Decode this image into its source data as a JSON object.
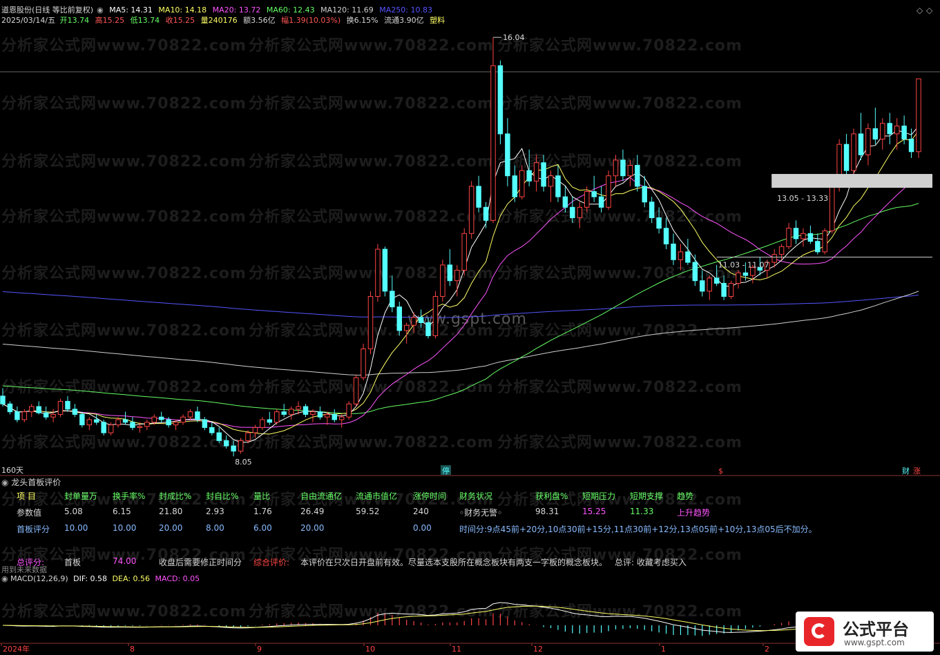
{
  "header": {
    "stock": "道恩股份(日线 等比前复权)",
    "ma": [
      {
        "label": "MA5: 14.31",
        "color": "#ffffff"
      },
      {
        "label": "MA10: 14.18",
        "color": "#ffff66"
      },
      {
        "label": "MA20: 13.72",
        "color": "#ff55ff"
      },
      {
        "label": "MA60: 12.43",
        "color": "#66ff66"
      },
      {
        "label": "MA120: 11.69",
        "color": "#d0d0d0"
      },
      {
        "label": "MA250: 10.83",
        "color": "#5555ff"
      }
    ],
    "date": "2025/03/14/五",
    "open_label": "开",
    "open": "13.74",
    "high_label": "高",
    "high": "15.25",
    "low_label": "低",
    "low": "13.74",
    "close_label": "收",
    "close": "15.25",
    "vol": "量240176",
    "amount": "额3.56亿",
    "change": "幅1.39(10.03%)",
    "turnover": "换6.15%",
    "float": "流通3.90亿",
    "industry": "塑料"
  },
  "watermarks": [
    "分析家公式网www.70822.com",
    "www.gspt.com"
  ],
  "chart_data": {
    "type": "candlestick",
    "period_label": "160天",
    "y_annotations": {
      "max": "16.04",
      "min": "8.05",
      "zone_high": "13.05 - 13.33",
      "zone_low": "11.03 - 11.07"
    },
    "x_ticks": [
      "2024年",
      "8",
      "9",
      "10",
      "11",
      "12",
      "1",
      "2"
    ],
    "markers": [
      "停",
      "$",
      "财",
      "涨"
    ],
    "ohlc": [
      [
        9.2,
        9.35,
        9.0,
        9.05
      ],
      [
        9.05,
        9.1,
        8.85,
        8.9
      ],
      [
        8.9,
        9.0,
        8.7,
        8.75
      ],
      [
        8.75,
        8.95,
        8.7,
        8.9
      ],
      [
        8.9,
        9.05,
        8.8,
        9.0
      ],
      [
        9.0,
        9.1,
        8.85,
        8.88
      ],
      [
        8.88,
        9.0,
        8.75,
        8.8
      ],
      [
        8.8,
        8.95,
        8.7,
        8.85
      ],
      [
        8.85,
        9.15,
        8.8,
        9.1
      ],
      [
        9.1,
        9.2,
        8.9,
        8.95
      ],
      [
        8.95,
        9.05,
        8.8,
        8.85
      ],
      [
        8.85,
        8.9,
        8.6,
        8.65
      ],
      [
        8.65,
        8.8,
        8.55,
        8.75
      ],
      [
        8.75,
        8.85,
        8.65,
        8.7
      ],
      [
        8.7,
        8.75,
        8.45,
        8.5
      ],
      [
        8.5,
        8.7,
        8.45,
        8.65
      ],
      [
        8.65,
        8.8,
        8.6,
        8.75
      ],
      [
        8.75,
        8.9,
        8.65,
        8.7
      ],
      [
        8.7,
        8.8,
        8.55,
        8.6
      ],
      [
        8.6,
        8.7,
        8.5,
        8.62
      ],
      [
        8.62,
        8.75,
        8.55,
        8.7
      ],
      [
        8.7,
        8.85,
        8.65,
        8.8
      ],
      [
        8.8,
        8.9,
        8.7,
        8.75
      ],
      [
        8.75,
        8.8,
        8.6,
        8.65
      ],
      [
        8.65,
        8.75,
        8.55,
        8.7
      ],
      [
        8.7,
        8.85,
        8.65,
        8.8
      ],
      [
        8.8,
        8.95,
        8.75,
        8.9
      ],
      [
        8.9,
        9.0,
        8.7,
        8.75
      ],
      [
        8.75,
        8.8,
        8.55,
        8.6
      ],
      [
        8.6,
        8.7,
        8.45,
        8.5
      ],
      [
        8.5,
        8.6,
        8.3,
        8.35
      ],
      [
        8.35,
        8.45,
        8.2,
        8.25
      ],
      [
        8.25,
        8.35,
        8.05,
        8.15
      ],
      [
        8.15,
        8.4,
        8.1,
        8.35
      ],
      [
        8.35,
        8.55,
        8.3,
        8.5
      ],
      [
        8.5,
        8.65,
        8.4,
        8.6
      ],
      [
        8.6,
        8.8,
        8.55,
        8.75
      ],
      [
        8.75,
        8.9,
        8.65,
        8.7
      ],
      [
        8.7,
        8.95,
        8.65,
        8.9
      ],
      [
        8.9,
        9.05,
        8.8,
        8.85
      ],
      [
        8.85,
        9.0,
        8.75,
        8.95
      ],
      [
        8.95,
        9.1,
        8.85,
        9.0
      ],
      [
        9.0,
        9.05,
        8.8,
        8.85
      ],
      [
        8.85,
        8.95,
        8.7,
        8.9
      ],
      [
        8.9,
        9.0,
        8.75,
        8.8
      ],
      [
        8.8,
        8.9,
        8.65,
        8.85
      ],
      [
        8.85,
        8.95,
        8.7,
        8.75
      ],
      [
        8.75,
        8.85,
        8.6,
        8.8
      ],
      [
        8.8,
        9.1,
        8.75,
        9.05
      ],
      [
        9.05,
        9.6,
        9.0,
        9.55
      ],
      [
        9.55,
        10.2,
        9.5,
        10.1
      ],
      [
        10.1,
        11.2,
        10.0,
        11.1
      ],
      [
        11.1,
        12.1,
        11.0,
        12.0
      ],
      [
        12.0,
        12.05,
        11.1,
        11.2
      ],
      [
        11.2,
        11.5,
        10.8,
        10.9
      ],
      [
        10.9,
        11.0,
        10.35,
        10.45
      ],
      [
        10.45,
        10.6,
        10.2,
        10.55
      ],
      [
        10.55,
        10.8,
        10.4,
        10.7
      ],
      [
        10.7,
        10.85,
        10.5,
        10.6
      ],
      [
        10.6,
        10.7,
        10.3,
        10.35
      ],
      [
        10.35,
        11.2,
        10.3,
        11.1
      ],
      [
        11.1,
        11.8,
        11.0,
        11.7
      ],
      [
        11.7,
        12.0,
        11.3,
        11.4
      ],
      [
        11.4,
        11.7,
        11.1,
        11.6
      ],
      [
        11.6,
        12.4,
        11.5,
        12.3
      ],
      [
        12.3,
        13.3,
        12.2,
        13.2
      ],
      [
        13.2,
        13.4,
        12.7,
        12.8
      ],
      [
        12.8,
        12.9,
        12.4,
        12.55
      ],
      [
        12.55,
        16.04,
        12.5,
        15.5
      ],
      [
        15.5,
        15.6,
        14.0,
        14.2
      ],
      [
        14.2,
        14.5,
        13.2,
        13.4
      ],
      [
        13.4,
        13.6,
        12.9,
        13.0
      ],
      [
        13.0,
        13.6,
        12.95,
        13.5
      ],
      [
        13.5,
        13.9,
        13.2,
        13.3
      ],
      [
        13.3,
        13.8,
        13.1,
        13.65
      ],
      [
        13.65,
        13.8,
        13.1,
        13.2
      ],
      [
        13.2,
        13.5,
        12.9,
        13.4
      ],
      [
        13.4,
        13.6,
        12.9,
        13.0
      ],
      [
        13.0,
        13.2,
        12.7,
        12.8
      ],
      [
        12.8,
        13.0,
        12.5,
        12.6
      ],
      [
        12.6,
        12.9,
        12.4,
        12.8
      ],
      [
        12.8,
        13.2,
        12.7,
        13.1
      ],
      [
        13.1,
        13.4,
        12.9,
        13.0
      ],
      [
        13.0,
        13.2,
        12.7,
        12.8
      ],
      [
        12.8,
        13.5,
        12.75,
        13.4
      ],
      [
        13.4,
        13.8,
        13.2,
        13.7
      ],
      [
        13.7,
        13.9,
        13.3,
        13.4
      ],
      [
        13.4,
        13.7,
        13.2,
        13.6
      ],
      [
        13.6,
        13.8,
        13.1,
        13.2
      ],
      [
        13.2,
        13.4,
        12.8,
        12.9
      ],
      [
        12.9,
        13.0,
        12.5,
        12.6
      ],
      [
        12.6,
        12.8,
        12.3,
        12.4
      ],
      [
        12.4,
        12.6,
        12.0,
        12.1
      ],
      [
        12.1,
        12.3,
        11.7,
        11.8
      ],
      [
        11.8,
        12.1,
        11.6,
        11.95
      ],
      [
        11.95,
        12.2,
        11.7,
        11.75
      ],
      [
        11.75,
        11.9,
        11.3,
        11.4
      ],
      [
        11.4,
        11.6,
        11.1,
        11.2
      ],
      [
        11.2,
        11.5,
        11.03,
        11.45
      ],
      [
        11.45,
        11.7,
        11.3,
        11.35
      ],
      [
        11.35,
        11.5,
        11.03,
        11.1
      ],
      [
        11.1,
        11.4,
        11.05,
        11.35
      ],
      [
        11.35,
        11.6,
        11.25,
        11.55
      ],
      [
        11.55,
        11.75,
        11.4,
        11.5
      ],
      [
        11.5,
        11.7,
        11.35,
        11.65
      ],
      [
        11.65,
        11.85,
        11.5,
        11.6
      ],
      [
        11.6,
        11.8,
        11.45,
        11.75
      ],
      [
        11.75,
        12.0,
        11.65,
        11.9
      ],
      [
        11.9,
        12.1,
        11.8,
        12.05
      ],
      [
        12.05,
        12.5,
        12.0,
        12.4
      ],
      [
        12.4,
        12.55,
        12.1,
        12.2
      ],
      [
        12.2,
        12.4,
        12.05,
        12.3
      ],
      [
        12.3,
        12.45,
        12.1,
        12.15
      ],
      [
        12.15,
        12.3,
        11.9,
        11.95
      ],
      [
        11.95,
        12.4,
        11.9,
        12.35
      ],
      [
        12.35,
        13.33,
        12.3,
        13.2
      ],
      [
        13.2,
        14.1,
        13.1,
        14.0
      ],
      [
        14.0,
        14.2,
        13.4,
        13.5
      ],
      [
        13.5,
        14.3,
        13.4,
        14.2
      ],
      [
        14.2,
        14.6,
        13.7,
        13.8
      ],
      [
        13.8,
        14.4,
        13.6,
        14.3
      ],
      [
        14.3,
        14.7,
        14.0,
        14.1
      ],
      [
        14.1,
        14.5,
        13.9,
        14.4
      ],
      [
        14.4,
        14.6,
        14.0,
        14.2
      ],
      [
        14.2,
        14.5,
        13.9,
        14.35
      ],
      [
        14.35,
        14.55,
        14.0,
        14.1
      ],
      [
        14.1,
        14.3,
        13.74,
        13.86
      ],
      [
        13.86,
        15.25,
        13.74,
        15.25
      ]
    ]
  },
  "panel": {
    "title": "龙头首板评价",
    "headers": [
      "项 目",
      "封单量万",
      "换手率%",
      "封成比%",
      "封自比%",
      "量比",
      "自由流通亿",
      "流通市值亿",
      "涨停时间",
      "财务状况",
      "获利盘%",
      "短期压力",
      "短期支撑",
      "趋势"
    ],
    "row1": [
      "参数值",
      "5.08",
      "6.15",
      "21.80",
      "2.93",
      "1.76",
      "26.49",
      "59.52",
      "240",
      "◦财务无警◦",
      "98.31",
      "15.25",
      "11.33",
      "上升趋势"
    ],
    "row2": [
      "首板评分",
      "10.00",
      "10.00",
      "20.00",
      "8.00",
      "6.00",
      "20.00",
      "",
      "0.00",
      "时间分:9点45前+20分,10点30前+15分,11点30前+12分,13点05前+10分,13点05后不加分。"
    ],
    "total_label": "总评分:",
    "total_type": "首板",
    "total_score": "74.00",
    "fix_note": "收盘后需要修正时间分",
    "overall_label": "综合评价:",
    "overall_text": "本评价在只次日开盘前有效。尽量选本支股所在概念板块有两支一字板的概念板块。",
    "summary": "总评: 收藏考虑买入",
    "future_note": "用到未来数据"
  },
  "macd": {
    "label": "MACD(12,26,9)",
    "dif": "DIF: 0.58",
    "dea": "DEA: 0.56",
    "macd": "MACD: 0.05"
  },
  "logo": {
    "title": "公式平台",
    "url": "www.gspt.com"
  },
  "colors": {
    "up": "#ff4444",
    "down": "#55ffff",
    "ma5": "#ffffff",
    "ma10": "#ffff66",
    "ma20": "#ff55ff",
    "ma60": "#66ff66",
    "ma120": "#d0d0d0",
    "ma250": "#5555ff"
  }
}
